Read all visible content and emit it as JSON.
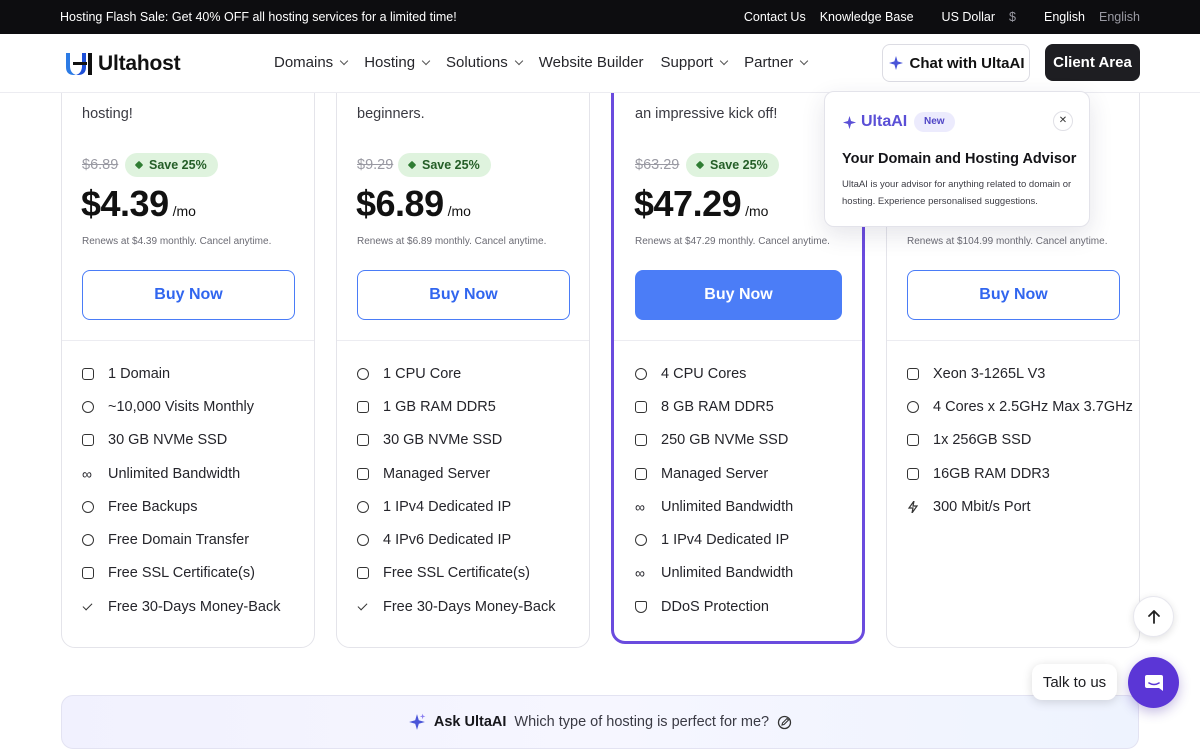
{
  "topbar": {
    "promo": "Hosting Flash Sale: Get 40% OFF all hosting services for a limited time!",
    "contact": "Contact Us",
    "kb": "Knowledge Base",
    "currency": "US Dollar",
    "currency_symbol": "$",
    "language": "English",
    "language_native": "English"
  },
  "header": {
    "logo": "Ultahost",
    "nav": [
      "Domains",
      "Hosting",
      "Solutions",
      "Website Builder",
      "Support",
      "Partner"
    ],
    "chat_button": "Chat with UltaAI",
    "client_button": "Client Area"
  },
  "plans": [
    {
      "tagline": "hosting!",
      "old_price": "$6.89",
      "save": "Save 25%",
      "price": "$4.39",
      "per": "/mo",
      "renew": "Renews at $4.39 monthly. Cancel anytime.",
      "buy": "Buy Now",
      "features": [
        "1 Domain",
        "~10,000 Visits Monthly",
        "30 GB NVMe SSD",
        "Unlimited Bandwidth",
        "Free Backups",
        "Free Domain Transfer",
        "Free SSL Certificate(s)",
        "Free 30-Days Money-Back"
      ]
    },
    {
      "tagline": "beginners.",
      "old_price": "$9.29",
      "save": "Save 25%",
      "price": "$6.89",
      "per": "/mo",
      "renew": "Renews at $6.89 monthly. Cancel anytime.",
      "buy": "Buy Now",
      "features": [
        "1 CPU Core",
        "1 GB RAM DDR5",
        "30 GB NVMe SSD",
        "Managed Server",
        "1 IPv4 Dedicated IP",
        "4 IPv6 Dedicated IP",
        "Free SSL Certificate(s)",
        "Free 30-Days Money-Back"
      ]
    },
    {
      "tagline": "an impressive kick off!",
      "old_price": "$63.29",
      "save": "Save 25%",
      "price": "$47.29",
      "per": "/mo",
      "renew": "Renews at $47.29 monthly. Cancel anytime.",
      "buy": "Buy Now",
      "features": [
        "4 CPU Cores",
        "8 GB RAM DDR5",
        "250 GB NVMe SSD",
        "Managed Server",
        "Unlimited Bandwidth",
        "1 IPv4 Dedicated IP",
        "Unlimited Bandwidth",
        "DDoS Protection"
      ]
    },
    {
      "renew": "Renews at $104.99 monthly. Cancel anytime.",
      "buy": "Buy Now",
      "features": [
        "Xeon 3-1265L V3",
        "4 Cores x 2.5GHz Max 3.7GHz",
        "1x 256GB SSD",
        "16GB RAM DDR3",
        "300 Mbit/s Port"
      ]
    }
  ],
  "popup": {
    "brand": "UltaAI",
    "badge": "New",
    "close": "✕",
    "heading": "Your Domain and Hosting Advisor",
    "description": "UltaAI is your advisor for anything related to domain or hosting. Experience personalised suggestions."
  },
  "askbar": {
    "label": "Ask UltaAI",
    "question": "Which type of hosting is perfect for me?"
  },
  "floating": {
    "talk": "Talk to us"
  },
  "colors": {
    "accent_blue": "#4b7df7",
    "featured_border": "#6a4bde",
    "save_green": "#dff3de",
    "ai_purple": "#5b36d6"
  }
}
